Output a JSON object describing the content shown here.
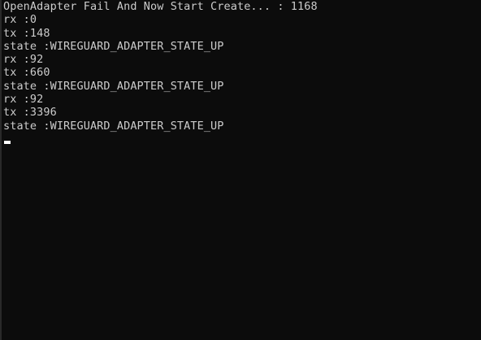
{
  "console": {
    "lines": [
      "OpenAdapter Fail And Now Start Create... : 1168",
      "rx :0",
      "tx :148",
      "state :WIREGUARD_ADAPTER_STATE_UP",
      "rx :92",
      "tx :660",
      "state :WIREGUARD_ADAPTER_STATE_UP",
      "rx :92",
      "tx :3396",
      "state :WIREGUARD_ADAPTER_STATE_UP"
    ]
  }
}
